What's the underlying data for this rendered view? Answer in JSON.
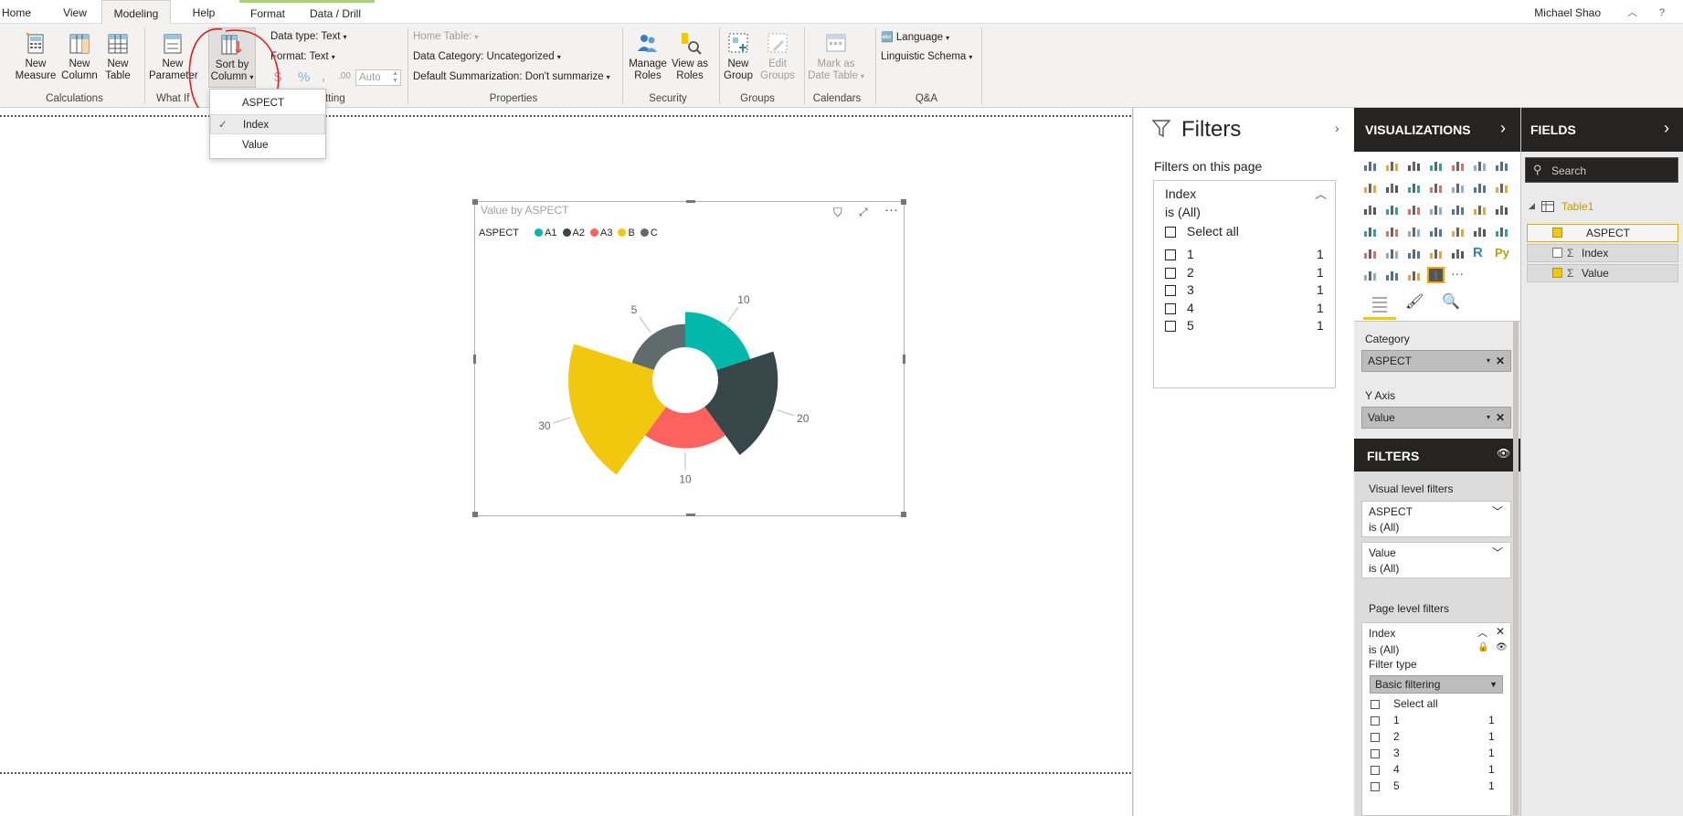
{
  "tabs": [
    "Home",
    "View",
    "Modeling",
    "Help",
    "Format",
    "Data / Drill"
  ],
  "user": "Michael Shao",
  "ribbon": {
    "buttons": {
      "new_measure": "New\nMeasure",
      "new_column": "New\nColumn",
      "new_table": "New\nTable",
      "new_parameter": "New\nParameter",
      "sort_by_column": "Sort by\nColumn",
      "manage_roles": "Manage\nRoles",
      "view_as_roles": "View as\nRoles",
      "new_group": "New\nGroup",
      "edit_groups": "Edit\nGroups",
      "mark_as_date_table": "Mark as\nDate Table"
    },
    "data_type": "Data type: Text",
    "format": "Format: Text",
    "currency": "$",
    "percent": "%",
    "comma": ",",
    "decimals": ".00",
    "auto": "Auto",
    "home_table": "Home Table:",
    "data_category": "Data Category: Uncategorized",
    "default_summarization": "Default Summarization: Don't summarize",
    "language": "Language",
    "linguistic_schema": "Linguistic Schema",
    "groups": {
      "calculations": "Calculations",
      "what_if": "What If",
      "formatting": "matting",
      "properties": "Properties",
      "security": "Security",
      "groups": "Groups",
      "calendars": "Calendars",
      "qa": "Q&A"
    }
  },
  "sort_menu": {
    "items": [
      "ASPECT (Default)",
      "Index",
      "Value"
    ],
    "selected_index": 1
  },
  "visual": {
    "title": "Value by ASPECT",
    "legend_title": "ASPECT",
    "colors": {
      "A1": "#01b8aa",
      "A2": "#374649",
      "A3": "#fd625e",
      "B": "#f2c80f",
      "C": "#5f6b6d"
    }
  },
  "chart_data": {
    "type": "pie",
    "subtype": "rose-donut",
    "title": "Value by ASPECT",
    "legend": [
      "A1",
      "A2",
      "A3",
      "B",
      "C"
    ],
    "categories": [
      "A1",
      "A2",
      "A3",
      "B",
      "C"
    ],
    "values": [
      10,
      20,
      10,
      30,
      5
    ],
    "data_labels": [
      "10",
      "20",
      "10",
      "30",
      "5"
    ]
  },
  "filters_pane": {
    "title": "Filters",
    "subtitle": "Filters on this page",
    "card_field": "Index",
    "card_state": "is (All)",
    "select_all": "Select all",
    "items": [
      {
        "label": "1",
        "count": "1"
      },
      {
        "label": "2",
        "count": "1"
      },
      {
        "label": "3",
        "count": "1"
      },
      {
        "label": "4",
        "count": "1"
      },
      {
        "label": "5",
        "count": "1"
      }
    ]
  },
  "viz_pane": {
    "title": "VISUALIZATIONS",
    "category_label": "Category",
    "category_value": "ASPECT",
    "yaxis_label": "Y Axis",
    "yaxis_value": "Value",
    "more": "···",
    "r_label": "R",
    "py_label": "Py",
    "filters_title": "FILTERS",
    "visual_level": "Visual level filters",
    "visual_filters": [
      {
        "field": "ASPECT",
        "state": "is (All)"
      },
      {
        "field": "Value",
        "state": "is (All)"
      }
    ],
    "page_level": "Page level filters",
    "page_filter_field": "Index",
    "page_filter_state": "is (All)",
    "filter_type_label": "Filter type",
    "filter_type_value": "Basic filtering",
    "select_all": "Select all",
    "items": [
      {
        "label": "1",
        "count": "1"
      },
      {
        "label": "2",
        "count": "1"
      },
      {
        "label": "3",
        "count": "1"
      },
      {
        "label": "4",
        "count": "1"
      },
      {
        "label": "5",
        "count": "1"
      }
    ]
  },
  "fields_pane": {
    "title": "FIELDS",
    "search_placeholder": "Search",
    "table": "Table1",
    "fields": [
      "ASPECT",
      "Index",
      "Value"
    ],
    "sigma": "Σ"
  }
}
